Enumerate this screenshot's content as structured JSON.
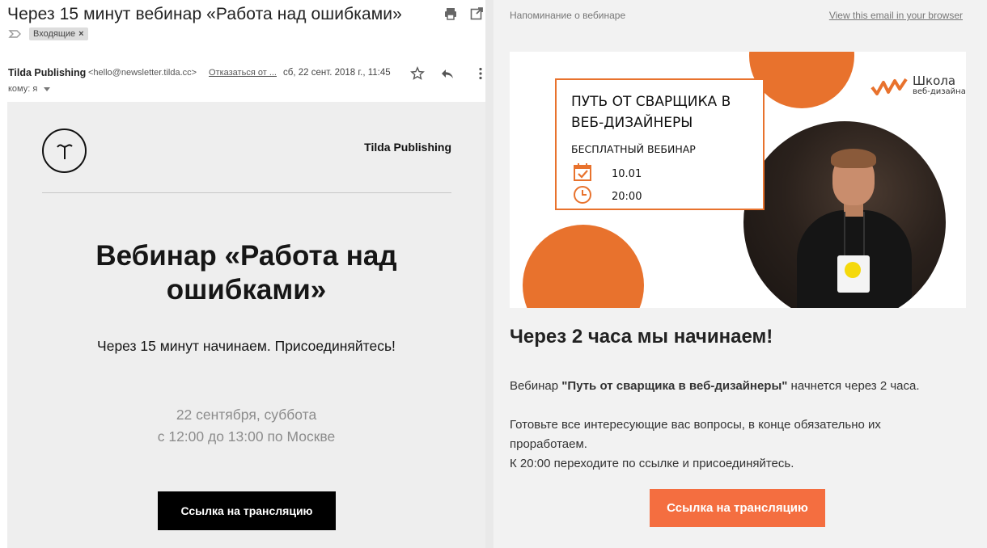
{
  "gmail": {
    "subject": "Через 15 минут вебинар «Работа над ошибками»",
    "label_chip": "Входящие",
    "sender_name": "Tilda Publishing",
    "sender_email": "<hello@newsletter.tilda.cc>",
    "unsubscribe": "Отказаться от ...",
    "date": "сб, 22 сент. 2018 г., 11:45",
    "to": "кому: я"
  },
  "left_email": {
    "brand": "Tilda Publishing",
    "title_line1": "Вебинар «Работа над",
    "title_line2": "ошибками»",
    "subtitle": "Через 15 минут начинаем. Присоединяйтесь!",
    "date_line1": "22 сентября, суббота",
    "date_line2": "с 12:00 до 13:00 по Москве",
    "button": "Ссылка на трансляцию"
  },
  "right_email": {
    "preheader": "Напоминание о вебинаре",
    "view_in_browser": "View this email in your browser",
    "banner": {
      "title_line1": "ПУТЬ ОТ СВАРЩИКА В",
      "title_line2": "ВЕБ-ДИЗАЙНЕРЫ",
      "subtitle": "БЕСПЛАТНЫЙ ВЕБИНАР",
      "date": "10.01",
      "time": "20:00",
      "school_name": "Школа",
      "school_sub": "веб-дизайна"
    },
    "heading": "Через 2 часа мы начинаем!",
    "para1_prefix": "Вебинар ",
    "para1_bold": "\"Путь от сварщика в веб-дизайнеры\"",
    "para1_suffix": " начнется через 2 часа.",
    "para2_line1": "Готовьте все интересующие вас вопросы, в конце обязательно их",
    "para2_line2": "проработаем.",
    "para2_line3": "К 20:00 переходите по ссылке и присоединяйтесь.",
    "button": "Ссылка на трансляцию"
  },
  "colors": {
    "accent_orange": "#e8722d",
    "button_orange": "#f46e40",
    "left_bg": "#eeeeee",
    "right_bg": "#f2f2f2"
  }
}
